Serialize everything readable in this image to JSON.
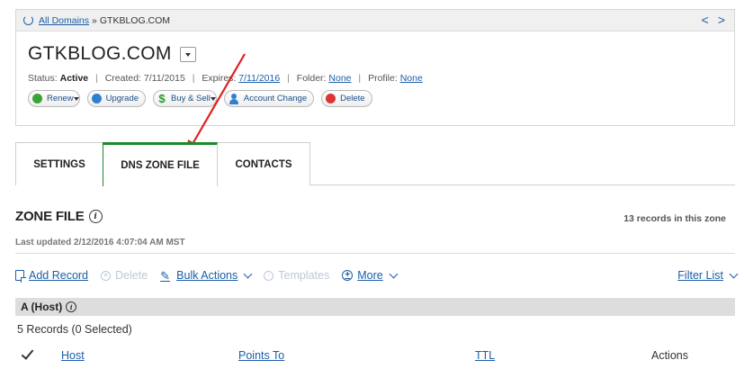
{
  "breadcrumb": {
    "root_label": "All Domains",
    "separator": "»",
    "current": "GTKBLOG.COM"
  },
  "pager": {
    "prev": "<",
    "next": ">"
  },
  "domain": {
    "name": "GTKBLOG.COM",
    "status_label": "Status:",
    "status_value": "Active",
    "created_label": "Created: 7/11/2015",
    "expires_label": "Expires:",
    "expires_value": "7/11/2016",
    "folder_label": "Folder:",
    "folder_value": "None",
    "profile_label": "Profile:",
    "profile_value": "None"
  },
  "actions": {
    "renew": "Renew",
    "upgrade": "Upgrade",
    "buy_sell": "Buy & Sell",
    "account_change": "Account Change",
    "delete": "Delete"
  },
  "tabs": [
    {
      "label": "SETTINGS",
      "active": false
    },
    {
      "label": "DNS ZONE FILE",
      "active": true
    },
    {
      "label": "CONTACTS",
      "active": false
    }
  ],
  "zone": {
    "title": "ZONE FILE",
    "records_count": "13 records in this zone",
    "last_updated": "Last updated 2/12/2016 4:07:04 AM MST"
  },
  "toolbar": {
    "add_record": "Add Record",
    "delete": "Delete",
    "bulk_actions": "Bulk Actions",
    "templates": "Templates",
    "more": "More",
    "filter_list": "Filter List"
  },
  "host_section": {
    "title": "A (Host)",
    "records_selected": "5 Records (0 Selected)"
  },
  "table": {
    "columns": [
      "Host",
      "Points To",
      "TTL",
      "Actions"
    ]
  },
  "colors": {
    "link": "#1b5ea8",
    "active_tab": "#1a8a2a",
    "annotation_arrow": "#e02020"
  }
}
